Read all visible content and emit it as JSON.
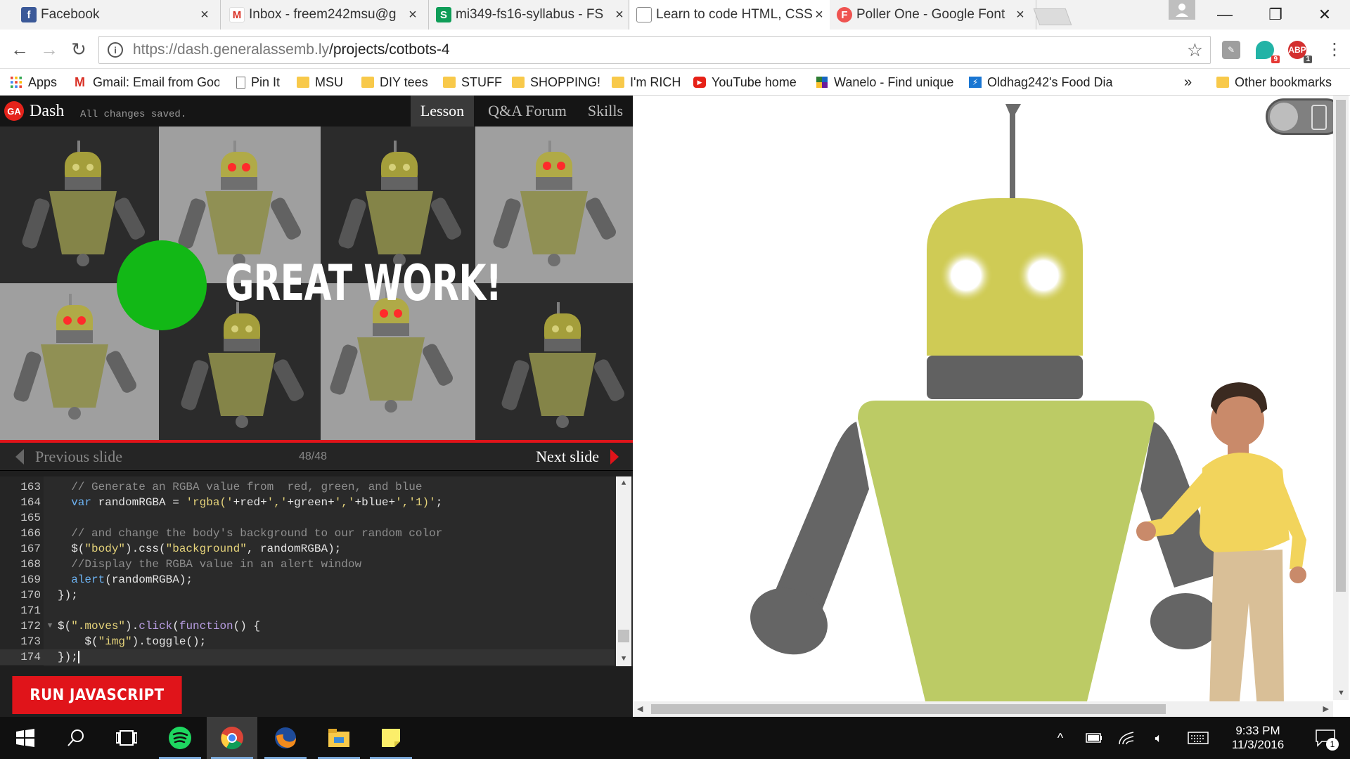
{
  "browser": {
    "tabs": [
      {
        "title": "Facebook",
        "icon": "facebook-icon",
        "color": "#3b5998",
        "active": false
      },
      {
        "title": "Inbox - freem242msu@g",
        "icon": "gmail-icon",
        "color": "#d93025",
        "active": false
      },
      {
        "title": "mi349-fs16-syllabus - FS",
        "icon": "sheets-icon",
        "color": "#0f9d58",
        "active": false
      },
      {
        "title": "Learn to code HTML, CSS",
        "icon": "page-icon",
        "color": "#555555",
        "active": true
      },
      {
        "title": "Poller One - Google Font",
        "icon": "google-fonts-icon",
        "color": "#ef5350",
        "active": false
      }
    ],
    "url_base": "https://dash.generalassemb.ly",
    "url_path": "/projects/cotbots-4",
    "extensions": [
      {
        "name": "pinterest-extension-icon",
        "badge": ""
      },
      {
        "name": "maps-extension-icon",
        "badge": "9"
      },
      {
        "name": "adblock-extension-icon",
        "label": "ABP",
        "badge": "1"
      }
    ]
  },
  "bookmarks": {
    "items": [
      {
        "label": "Apps",
        "icon": "apps-grid-icon"
      },
      {
        "label": "Gmail: Email from Goo",
        "icon": "gmail-icon"
      },
      {
        "label": "Pin It",
        "icon": "page-icon"
      },
      {
        "label": "MSU",
        "icon": "folder-icon"
      },
      {
        "label": "DIY tees",
        "icon": "folder-icon"
      },
      {
        "label": "STUFF",
        "icon": "folder-icon"
      },
      {
        "label": "SHOPPING!",
        "icon": "folder-icon"
      },
      {
        "label": "I'm RICH",
        "icon": "folder-icon"
      },
      {
        "label": "YouTube home",
        "icon": "youtube-icon"
      },
      {
        "label": "Wanelo - Find unique",
        "icon": "wanelo-icon"
      },
      {
        "label": "Oldhag242's Food Dia",
        "icon": "food-diary-icon"
      }
    ],
    "overflow": "»",
    "other": "Other bookmarks"
  },
  "dash": {
    "logo": "GA",
    "title": "Dash",
    "saved_status": "All changes saved.",
    "nav": [
      "Lesson",
      "Q&A Forum",
      "Skills"
    ],
    "active_nav": "Lesson",
    "banner_text": "GREAT WORK!",
    "prev_slide": "Previous slide",
    "slide_counter": "48/48",
    "next_slide": "Next slide",
    "run_button": "RUN JAVASCRIPT"
  },
  "editor": {
    "lines": [
      {
        "n": "163",
        "text": "  // Generate an RGBA value from  red, green, and blue"
      },
      {
        "n": "164",
        "text": "  var randomRGBA = 'rgba('+red+','+green+','+blue+','1)';"
      },
      {
        "n": "165",
        "text": ""
      },
      {
        "n": "166",
        "text": "  // and change the body's background to our random color"
      },
      {
        "n": "167",
        "text": "  $(\"body\").css(\"background\", randomRGBA);"
      },
      {
        "n": "168",
        "text": "  //Display the RGBA value in an alert window"
      },
      {
        "n": "169",
        "text": "  alert(randomRGBA);"
      },
      {
        "n": "170",
        "text": "});"
      },
      {
        "n": "171",
        "text": ""
      },
      {
        "n": "172",
        "text": "$(\".moves\").click(function() {"
      },
      {
        "n": "173",
        "text": "    $(\"img\").toggle();"
      },
      {
        "n": "174",
        "text": "});"
      }
    ],
    "current_line": "174",
    "fold_line": "172"
  },
  "taskbar": {
    "apps": [
      "start-button",
      "search-icon",
      "task-view-icon",
      "spotify-icon",
      "chrome-icon",
      "firefox-icon",
      "file-explorer-icon",
      "sticky-notes-icon"
    ],
    "time": "9:33 PM",
    "date": "11/3/2016",
    "notification_count": "1"
  },
  "colors": {
    "accent_red": "#e0141a",
    "robot_head": "#cfcb55",
    "robot_body": "#bccb65",
    "robot_arm": "#666666"
  }
}
